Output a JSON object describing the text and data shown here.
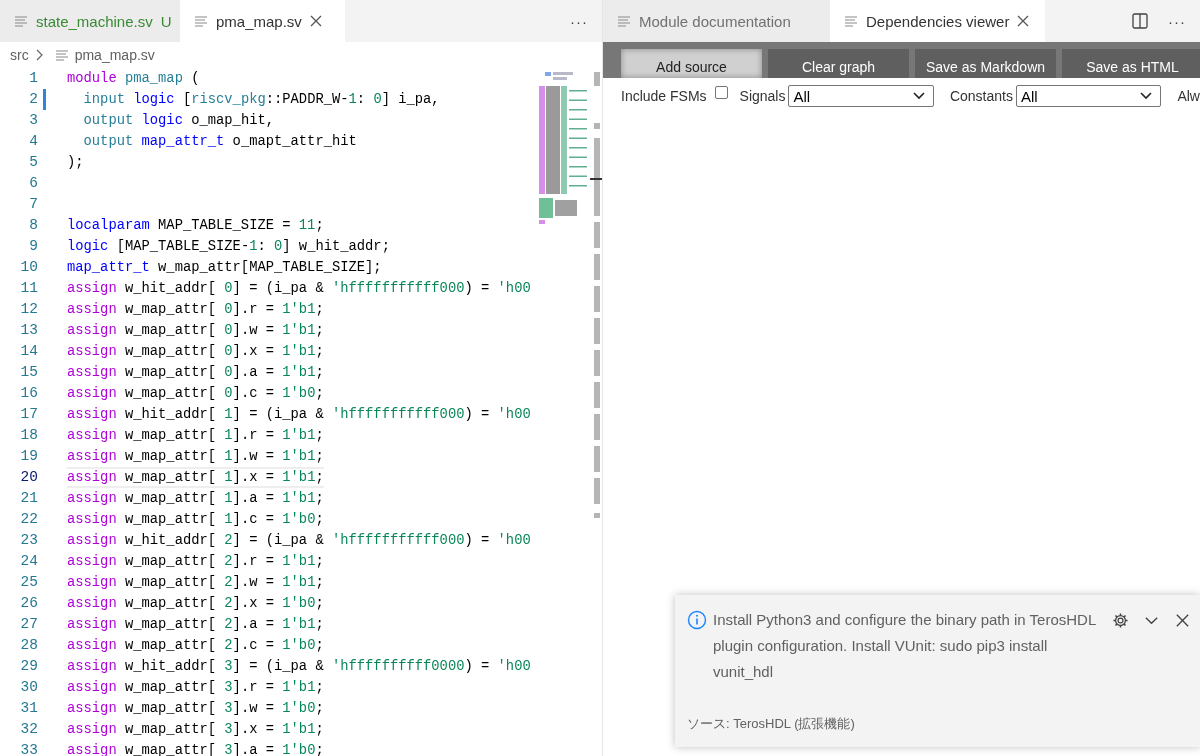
{
  "left_group": {
    "tabs": [
      {
        "label": "state_machine.sv",
        "git_status": "U",
        "selected": false,
        "closable": false
      },
      {
        "label": "pma_map.sv",
        "selected": true,
        "closable": true
      }
    ],
    "more": "···",
    "breadcrumb": [
      "src",
      "pma_map.sv"
    ],
    "code_lines": [
      {
        "number": "1",
        "current": false,
        "modified": false,
        "tokens": [
          {
            "kind": "ctrl",
            "text": "module"
          },
          {
            "kind": "ty",
            "text": " pma_map"
          },
          {
            "kind": "txt",
            "text": " ("
          }
        ]
      },
      {
        "number": "2",
        "current": false,
        "modified": true,
        "tokens": [
          {
            "kind": "ty",
            "text": "  input"
          },
          {
            "kind": "kw",
            "text": " logic"
          },
          {
            "kind": "txt",
            "text": " ["
          },
          {
            "kind": "ty",
            "text": "riscv_pkg"
          },
          {
            "kind": "txt",
            "text": "::PADDR_W-"
          },
          {
            "kind": "num",
            "text": "1"
          },
          {
            "kind": "txt",
            "text": ": "
          },
          {
            "kind": "num",
            "text": "0"
          },
          {
            "kind": "txt",
            "text": "] i_pa,"
          }
        ]
      },
      {
        "number": "3",
        "current": false,
        "modified": false,
        "tokens": [
          {
            "kind": "ty",
            "text": "  output"
          },
          {
            "kind": "kw",
            "text": " logic"
          },
          {
            "kind": "txt",
            "text": " o_map_hit,"
          }
        ]
      },
      {
        "number": "4",
        "current": false,
        "modified": false,
        "tokens": [
          {
            "kind": "ty",
            "text": "  output"
          },
          {
            "kind": "kw",
            "text": " map_attr_t"
          },
          {
            "kind": "txt",
            "text": " o_mapt_attr_hit"
          }
        ]
      },
      {
        "number": "5",
        "current": false,
        "modified": false,
        "tokens": [
          {
            "kind": "txt",
            "text": ");"
          }
        ]
      },
      {
        "number": "6",
        "current": false,
        "modified": false
      },
      {
        "number": "7",
        "current": false,
        "modified": false
      },
      {
        "number": "8",
        "current": false,
        "modified": false,
        "tokens": [
          {
            "kind": "kw",
            "text": "localparam"
          },
          {
            "kind": "txt",
            "text": " MAP_TABLE_SIZE = "
          },
          {
            "kind": "num",
            "text": "11"
          },
          {
            "kind": "txt",
            "text": ";"
          }
        ]
      },
      {
        "number": "9",
        "current": false,
        "modified": false,
        "tokens": [
          {
            "kind": "kw",
            "text": "logic"
          },
          {
            "kind": "txt",
            "text": " [MAP_TABLE_SIZE-"
          },
          {
            "kind": "num",
            "text": "1"
          },
          {
            "kind": "txt",
            "text": ": "
          },
          {
            "kind": "num",
            "text": "0"
          },
          {
            "kind": "txt",
            "text": "] w_hit_addr;"
          }
        ]
      },
      {
        "number": "10",
        "current": false,
        "modified": false,
        "tokens": [
          {
            "kind": "kw",
            "text": "map_attr_t"
          },
          {
            "kind": "txt",
            "text": " w_map_attr[MAP_TABLE_SIZE];"
          }
        ]
      },
      {
        "number": "11",
        "current": false,
        "modified": false,
        "tokens": [
          {
            "kind": "ctrl",
            "text": "assign"
          },
          {
            "kind": "txt",
            "text": " w_hit_addr[ "
          },
          {
            "kind": "num",
            "text": "0"
          },
          {
            "kind": "txt",
            "text": "] = (i_pa & "
          },
          {
            "kind": "num",
            "text": "'hfffffffffff000"
          },
          {
            "kind": "txt",
            "text": ") = "
          },
          {
            "kind": "num",
            "text": "'h00"
          }
        ]
      },
      {
        "number": "12",
        "current": false,
        "modified": false,
        "tokens": [
          {
            "kind": "ctrl",
            "text": "assign"
          },
          {
            "kind": "txt",
            "text": " w_map_attr[ "
          },
          {
            "kind": "num",
            "text": "0"
          },
          {
            "kind": "txt",
            "text": "].r = "
          },
          {
            "kind": "num",
            "text": "1'b1"
          },
          {
            "kind": "txt",
            "text": ";"
          }
        ]
      },
      {
        "number": "13",
        "current": false,
        "modified": false,
        "tokens": [
          {
            "kind": "ctrl",
            "text": "assign"
          },
          {
            "kind": "txt",
            "text": " w_map_attr[ "
          },
          {
            "kind": "num",
            "text": "0"
          },
          {
            "kind": "txt",
            "text": "].w = "
          },
          {
            "kind": "num",
            "text": "1'b1"
          },
          {
            "kind": "txt",
            "text": ";"
          }
        ]
      },
      {
        "number": "14",
        "current": false,
        "modified": false,
        "tokens": [
          {
            "kind": "ctrl",
            "text": "assign"
          },
          {
            "kind": "txt",
            "text": " w_map_attr[ "
          },
          {
            "kind": "num",
            "text": "0"
          },
          {
            "kind": "txt",
            "text": "].x = "
          },
          {
            "kind": "num",
            "text": "1'b1"
          },
          {
            "kind": "txt",
            "text": ";"
          }
        ]
      },
      {
        "number": "15",
        "current": false,
        "modified": false,
        "tokens": [
          {
            "kind": "ctrl",
            "text": "assign"
          },
          {
            "kind": "txt",
            "text": " w_map_attr[ "
          },
          {
            "kind": "num",
            "text": "0"
          },
          {
            "kind": "txt",
            "text": "].a = "
          },
          {
            "kind": "num",
            "text": "1'b1"
          },
          {
            "kind": "txt",
            "text": ";"
          }
        ]
      },
      {
        "number": "16",
        "current": false,
        "modified": false,
        "tokens": [
          {
            "kind": "ctrl",
            "text": "assign"
          },
          {
            "kind": "txt",
            "text": " w_map_attr[ "
          },
          {
            "kind": "num",
            "text": "0"
          },
          {
            "kind": "txt",
            "text": "].c = "
          },
          {
            "kind": "num",
            "text": "1'b0"
          },
          {
            "kind": "txt",
            "text": ";"
          }
        ]
      },
      {
        "number": "17",
        "current": false,
        "modified": false,
        "tokens": [
          {
            "kind": "ctrl",
            "text": "assign"
          },
          {
            "kind": "txt",
            "text": " w_hit_addr[ "
          },
          {
            "kind": "num",
            "text": "1"
          },
          {
            "kind": "txt",
            "text": "] = (i_pa & "
          },
          {
            "kind": "num",
            "text": "'hfffffffffff000"
          },
          {
            "kind": "txt",
            "text": ") = "
          },
          {
            "kind": "num",
            "text": "'h00"
          }
        ]
      },
      {
        "number": "18",
        "current": false,
        "modified": false,
        "tokens": [
          {
            "kind": "ctrl",
            "text": "assign"
          },
          {
            "kind": "txt",
            "text": " w_map_attr[ "
          },
          {
            "kind": "num",
            "text": "1"
          },
          {
            "kind": "txt",
            "text": "].r = "
          },
          {
            "kind": "num",
            "text": "1'b1"
          },
          {
            "kind": "txt",
            "text": ";"
          }
        ]
      },
      {
        "number": "19",
        "current": false,
        "modified": false,
        "tokens": [
          {
            "kind": "ctrl",
            "text": "assign"
          },
          {
            "kind": "txt",
            "text": " w_map_attr[ "
          },
          {
            "kind": "num",
            "text": "1"
          },
          {
            "kind": "txt",
            "text": "].w = "
          },
          {
            "kind": "num",
            "text": "1'b1"
          },
          {
            "kind": "txt",
            "text": ";"
          }
        ]
      },
      {
        "number": "20",
        "current": true,
        "modified": false,
        "tokens": [
          {
            "kind": "ctrl",
            "text": "assign"
          },
          {
            "kind": "txt",
            "text": " w_map_attr[ "
          },
          {
            "kind": "num",
            "text": "1"
          },
          {
            "kind": "txt",
            "text": "].x = "
          },
          {
            "kind": "num",
            "text": "1'b1"
          },
          {
            "kind": "txt",
            "text": ";"
          }
        ]
      },
      {
        "number": "21",
        "current": false,
        "modified": false,
        "tokens": [
          {
            "kind": "ctrl",
            "text": "assign"
          },
          {
            "kind": "txt",
            "text": " w_map_attr[ "
          },
          {
            "kind": "num",
            "text": "1"
          },
          {
            "kind": "txt",
            "text": "].a = "
          },
          {
            "kind": "num",
            "text": "1'b1"
          },
          {
            "kind": "txt",
            "text": ";"
          }
        ]
      },
      {
        "number": "22",
        "current": false,
        "modified": false,
        "tokens": [
          {
            "kind": "ctrl",
            "text": "assign"
          },
          {
            "kind": "txt",
            "text": " w_map_attr[ "
          },
          {
            "kind": "num",
            "text": "1"
          },
          {
            "kind": "txt",
            "text": "].c = "
          },
          {
            "kind": "num",
            "text": "1'b0"
          },
          {
            "kind": "txt",
            "text": ";"
          }
        ]
      },
      {
        "number": "23",
        "current": false,
        "modified": false,
        "tokens": [
          {
            "kind": "ctrl",
            "text": "assign"
          },
          {
            "kind": "txt",
            "text": " w_hit_addr[ "
          },
          {
            "kind": "num",
            "text": "2"
          },
          {
            "kind": "txt",
            "text": "] = (i_pa & "
          },
          {
            "kind": "num",
            "text": "'hfffffffffff000"
          },
          {
            "kind": "txt",
            "text": ") = "
          },
          {
            "kind": "num",
            "text": "'h00"
          }
        ]
      },
      {
        "number": "24",
        "current": false,
        "modified": false,
        "tokens": [
          {
            "kind": "ctrl",
            "text": "assign"
          },
          {
            "kind": "txt",
            "text": " w_map_attr[ "
          },
          {
            "kind": "num",
            "text": "2"
          },
          {
            "kind": "txt",
            "text": "].r = "
          },
          {
            "kind": "num",
            "text": "1'b1"
          },
          {
            "kind": "txt",
            "text": ";"
          }
        ]
      },
      {
        "number": "25",
        "current": false,
        "modified": false,
        "tokens": [
          {
            "kind": "ctrl",
            "text": "assign"
          },
          {
            "kind": "txt",
            "text": " w_map_attr[ "
          },
          {
            "kind": "num",
            "text": "2"
          },
          {
            "kind": "txt",
            "text": "].w = "
          },
          {
            "kind": "num",
            "text": "1'b1"
          },
          {
            "kind": "txt",
            "text": ";"
          }
        ]
      },
      {
        "number": "26",
        "current": false,
        "modified": false,
        "tokens": [
          {
            "kind": "ctrl",
            "text": "assign"
          },
          {
            "kind": "txt",
            "text": " w_map_attr[ "
          },
          {
            "kind": "num",
            "text": "2"
          },
          {
            "kind": "txt",
            "text": "].x = "
          },
          {
            "kind": "num",
            "text": "1'b0"
          },
          {
            "kind": "txt",
            "text": ";"
          }
        ]
      },
      {
        "number": "27",
        "current": false,
        "modified": false,
        "tokens": [
          {
            "kind": "ctrl",
            "text": "assign"
          },
          {
            "kind": "txt",
            "text": " w_map_attr[ "
          },
          {
            "kind": "num",
            "text": "2"
          },
          {
            "kind": "txt",
            "text": "].a = "
          },
          {
            "kind": "num",
            "text": "1'b1"
          },
          {
            "kind": "txt",
            "text": ";"
          }
        ]
      },
      {
        "number": "28",
        "current": false,
        "modified": false,
        "tokens": [
          {
            "kind": "ctrl",
            "text": "assign"
          },
          {
            "kind": "txt",
            "text": " w_map_attr[ "
          },
          {
            "kind": "num",
            "text": "2"
          },
          {
            "kind": "txt",
            "text": "].c = "
          },
          {
            "kind": "num",
            "text": "1'b0"
          },
          {
            "kind": "txt",
            "text": ";"
          }
        ]
      },
      {
        "number": "29",
        "current": false,
        "modified": false,
        "tokens": [
          {
            "kind": "ctrl",
            "text": "assign"
          },
          {
            "kind": "txt",
            "text": " w_hit_addr[ "
          },
          {
            "kind": "num",
            "text": "3"
          },
          {
            "kind": "txt",
            "text": "] = (i_pa & "
          },
          {
            "kind": "num",
            "text": "'hffffffffff0000"
          },
          {
            "kind": "txt",
            "text": ") = "
          },
          {
            "kind": "num",
            "text": "'h00"
          }
        ]
      },
      {
        "number": "30",
        "current": false,
        "modified": false,
        "tokens": [
          {
            "kind": "ctrl",
            "text": "assign"
          },
          {
            "kind": "txt",
            "text": " w_map_attr[ "
          },
          {
            "kind": "num",
            "text": "3"
          },
          {
            "kind": "txt",
            "text": "].r = "
          },
          {
            "kind": "num",
            "text": "1'b1"
          },
          {
            "kind": "txt",
            "text": ";"
          }
        ]
      },
      {
        "number": "31",
        "current": false,
        "modified": false,
        "tokens": [
          {
            "kind": "ctrl",
            "text": "assign"
          },
          {
            "kind": "txt",
            "text": " w_map_attr[ "
          },
          {
            "kind": "num",
            "text": "3"
          },
          {
            "kind": "txt",
            "text": "].w = "
          },
          {
            "kind": "num",
            "text": "1'b0"
          },
          {
            "kind": "txt",
            "text": ";"
          }
        ]
      },
      {
        "number": "32",
        "current": false,
        "modified": false,
        "tokens": [
          {
            "kind": "ctrl",
            "text": "assign"
          },
          {
            "kind": "txt",
            "text": " w_map_attr[ "
          },
          {
            "kind": "num",
            "text": "3"
          },
          {
            "kind": "txt",
            "text": "].x = "
          },
          {
            "kind": "num",
            "text": "1'b1"
          },
          {
            "kind": "txt",
            "text": ";"
          }
        ]
      },
      {
        "number": "33",
        "current": false,
        "modified": false,
        "tokens": [
          {
            "kind": "ctrl",
            "text": "assign"
          },
          {
            "kind": "txt",
            "text": " w_map_attr[ "
          },
          {
            "kind": "num",
            "text": "3"
          },
          {
            "kind": "txt",
            "text": "].a = "
          },
          {
            "kind": "num",
            "text": "1'b0"
          },
          {
            "kind": "txt",
            "text": ";"
          }
        ]
      }
    ]
  },
  "right_group": {
    "tabs": [
      {
        "label": "Module documentation",
        "selected": false,
        "closable": false
      },
      {
        "label": "Dependencies viewer",
        "selected": true,
        "closable": true
      }
    ],
    "more": "···",
    "toolbar_buttons": [
      {
        "label": "Add source",
        "hovered": true
      },
      {
        "label": "Clear graph",
        "hovered": false
      },
      {
        "label": "Save as Markdown",
        "hovered": false
      },
      {
        "label": "Save as HTML",
        "hovered": false
      }
    ],
    "include_fsms": {
      "label": "Include FSMs",
      "checked": false
    },
    "selects": [
      {
        "label": "Signals",
        "value": "All"
      },
      {
        "label": "Constants",
        "value": "All"
      }
    ],
    "cut_label": "Alw"
  },
  "notification": {
    "message": "Install Python3 and configure the binary path in TerosHDL plugin configuration. Install VUnit: sudo pip3 install vunit_hdl",
    "source": "ソース: TerosHDL (拡張機能)"
  }
}
